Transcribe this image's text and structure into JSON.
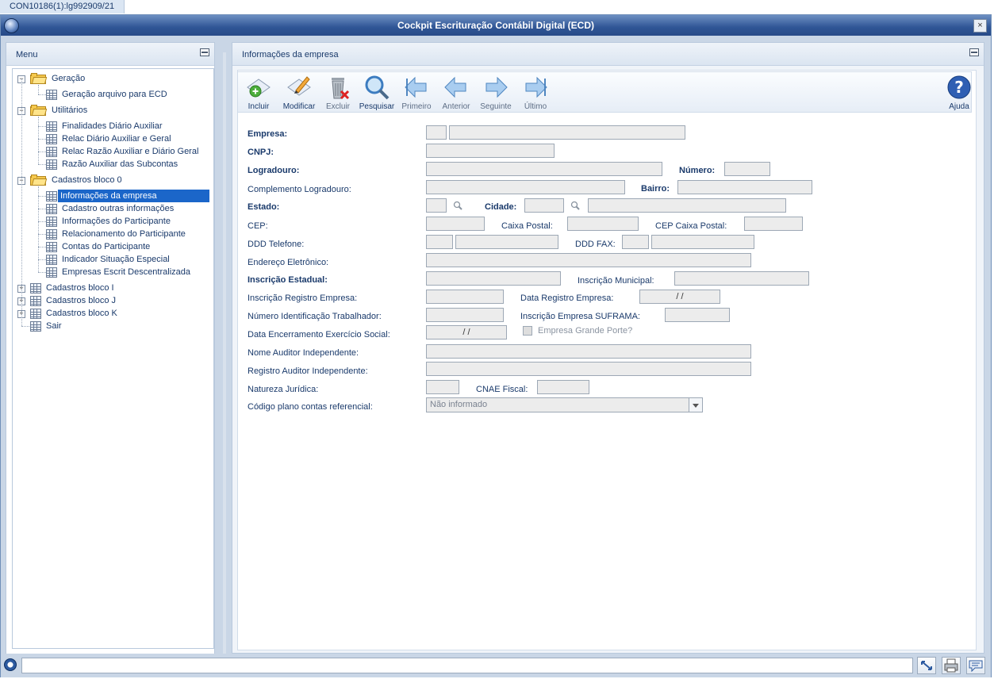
{
  "tab": {
    "label": "CON10186(1):lg992909/21"
  },
  "window": {
    "title": "Cockpit Escrituração Contábil Digital (ECD)",
    "close_label": "×"
  },
  "menu": {
    "title": "Menu",
    "tree": [
      {
        "label": "Geração",
        "type": "folder",
        "level": 0,
        "expanded": true
      },
      {
        "label": "Geração arquivo para ECD",
        "type": "item",
        "level": 1
      },
      {
        "label": "Utilitários",
        "type": "folder",
        "level": 0,
        "expanded": true
      },
      {
        "label": "Finalidades Diário Auxiliar",
        "type": "item",
        "level": 1
      },
      {
        "label": "Relac Diário Auxiliar e Geral",
        "type": "item",
        "level": 1
      },
      {
        "label": "Relac Razão Auxiliar e Diário Geral",
        "type": "item",
        "level": 1
      },
      {
        "label": "Razão Auxiliar das Subcontas",
        "type": "item",
        "level": 1
      },
      {
        "label": "Cadastros bloco 0",
        "type": "folder",
        "level": 0,
        "expanded": true
      },
      {
        "label": "Informações da empresa",
        "type": "item",
        "level": 1,
        "selected": true
      },
      {
        "label": "Cadastro outras informações",
        "type": "item",
        "level": 1
      },
      {
        "label": "Informações do Participante",
        "type": "item",
        "level": 1
      },
      {
        "label": "Relacionamento do Participante",
        "type": "item",
        "level": 1
      },
      {
        "label": "Contas do Participante",
        "type": "item",
        "level": 1
      },
      {
        "label": "Indicador Situação Especial",
        "type": "item",
        "level": 1
      },
      {
        "label": "Empresas Escrit Descentralizada",
        "type": "item",
        "level": 1
      },
      {
        "label": "Cadastros bloco I",
        "type": "grid-collapsed",
        "level": 0
      },
      {
        "label": "Cadastros bloco J",
        "type": "grid-collapsed",
        "level": 0
      },
      {
        "label": "Cadastros bloco K",
        "type": "grid-collapsed",
        "level": 0
      },
      {
        "label": "Sair",
        "type": "grid",
        "level": 0
      }
    ]
  },
  "content": {
    "title": "Informações da empresa",
    "toolbar": {
      "incluir": "Incluir",
      "modificar": "Modificar",
      "excluir": "Excluir",
      "pesquisar": "Pesquisar",
      "primeiro": "Primeiro",
      "anterior": "Anterior",
      "seguinte": "Seguinte",
      "ultimo": "Último",
      "ajuda": "Ajuda"
    },
    "form": {
      "empresa": "Empresa:",
      "cnpj": "CNPJ:",
      "logradouro": "Logradouro:",
      "numero": "Número:",
      "complemento": "Complemento Logradouro:",
      "bairro": "Bairro:",
      "estado": "Estado:",
      "cidade": "Cidade:",
      "cep": "CEP:",
      "caixa_postal": "Caixa Postal:",
      "cep_caixa_postal": "CEP Caixa Postal:",
      "ddd_telefone": "DDD Telefone:",
      "ddd_fax": "DDD FAX:",
      "endereco_eletronico": "Endereço Eletrônico:",
      "inscricao_estadual": "Inscrição Estadual:",
      "inscricao_municipal": "Inscrição Municipal:",
      "inscricao_registro": "Inscrição Registro Empresa:",
      "data_registro": "Data Registro Empresa:",
      "data_registro_value": " / /",
      "numero_identificacao": "Número Identificação Trabalhador:",
      "inscricao_suframa": "Inscrição Empresa SUFRAMA:",
      "data_encerramento": "Data Encerramento Exercício Social:",
      "data_encerramento_value": " / /",
      "grande_porte": "Empresa Grande Porte?",
      "nome_auditor": "Nome Auditor Independente:",
      "registro_auditor": "Registro Auditor Independente:",
      "natureza_juridica": "Natureza Jurídica:",
      "cnae_fiscal": "CNAE Fiscal:",
      "codigo_plano": "Código plano contas referencial:",
      "codigo_plano_value": "Não informado"
    }
  },
  "colors": {
    "titlebar": "#2f5595",
    "selection": "#1b66c9",
    "text": "#1a3a6b",
    "field": "#ececec"
  }
}
